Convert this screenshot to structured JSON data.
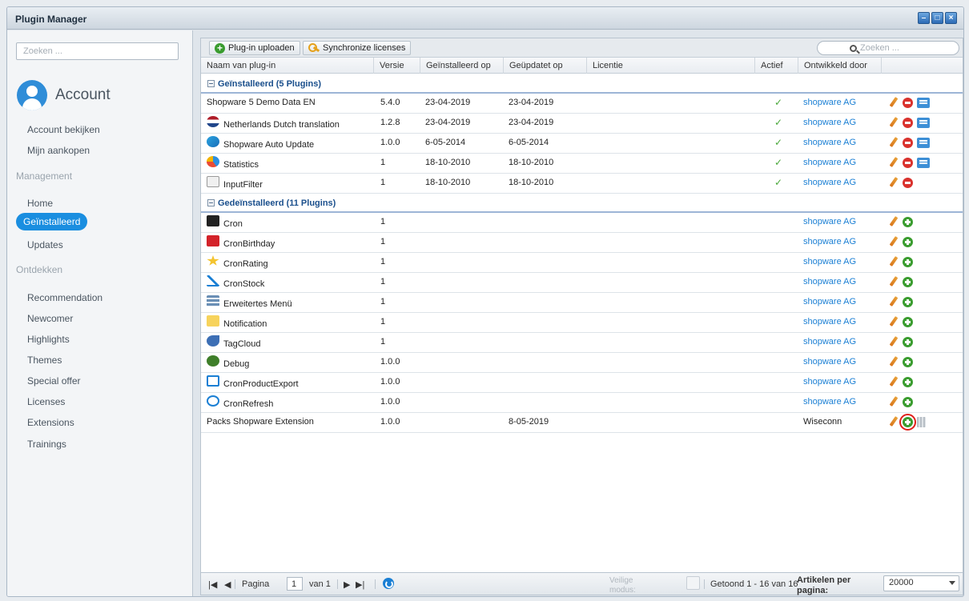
{
  "window": {
    "title": "Plugin Manager"
  },
  "sidebar": {
    "search_placeholder": "Zoeken ...",
    "account_label": "Account",
    "items": {
      "account_view": "Account bekijken",
      "purchases": "Mijn aankopen",
      "management": "Management",
      "home": "Home",
      "installed": "Geïnstalleerd",
      "updates": "Updates",
      "discover": "Ontdekken",
      "recommendation": "Recommendation",
      "newcomer": "Newcomer",
      "highlights": "Highlights",
      "themes": "Themes",
      "special_offer": "Special offer",
      "licenses": "Licenses",
      "extensions": "Extensions",
      "trainings": "Trainings"
    }
  },
  "toolbar": {
    "upload_label": "Plug-in uploaden",
    "sync_label": "Synchronize licenses",
    "search_placeholder": "Zoeken ..."
  },
  "columns": {
    "name": "Naam van plug-in",
    "version": "Versie",
    "installed": "Geïnstalleerd op",
    "updated": "Geüpdatet op",
    "license": "Licentie",
    "active": "Actief",
    "developer": "Ontwikkeld door"
  },
  "groups": {
    "installed": "Geïnstalleerd (5 Plugins)",
    "uninstalled": "Gedeïnstalleerd (11 Plugins)"
  },
  "installed_rows": [
    {
      "name": "Shopware 5 Demo Data EN",
      "version": "5.4.0",
      "installed": "23-04-2019",
      "updated": "23-04-2019",
      "active": "✓",
      "developer": "shopware AG",
      "icon": "none"
    },
    {
      "name": "Netherlands Dutch translation",
      "version": "1.2.8",
      "installed": "23-04-2019",
      "updated": "23-04-2019",
      "active": "✓",
      "developer": "shopware AG",
      "icon": "flag-nl-icon"
    },
    {
      "name": "Shopware Auto Update",
      "version": "1.0.0",
      "installed": "6-05-2014",
      "updated": "6-05-2014",
      "active": "✓",
      "developer": "shopware AG",
      "icon": "update-arrows-icon"
    },
    {
      "name": "Statistics",
      "version": "1",
      "installed": "18-10-2010",
      "updated": "18-10-2010",
      "active": "✓",
      "developer": "shopware AG",
      "icon": "pie-chart-icon"
    },
    {
      "name": "InputFilter",
      "version": "1",
      "installed": "18-10-2010",
      "updated": "18-10-2010",
      "active": "✓",
      "developer": "shopware AG",
      "icon": "text-cursor-icon"
    }
  ],
  "uninstalled_rows": [
    {
      "name": "Cron",
      "version": "1",
      "developer": "shopware AG",
      "icon": "terminal-icon"
    },
    {
      "name": "CronBirthday",
      "version": "1",
      "developer": "shopware AG",
      "icon": "gift-icon"
    },
    {
      "name": "CronRating",
      "version": "1",
      "developer": "shopware AG",
      "icon": "star-icon"
    },
    {
      "name": "CronStock",
      "version": "1",
      "developer": "shopware AG",
      "icon": "stock-chart-icon"
    },
    {
      "name": "Erweitertes Menü",
      "version": "1",
      "developer": "shopware AG",
      "icon": "menu-icon"
    },
    {
      "name": "Notification",
      "version": "1",
      "developer": "shopware AG",
      "icon": "note-icon"
    },
    {
      "name": "TagCloud",
      "version": "1",
      "developer": "shopware AG",
      "icon": "tag-icon"
    },
    {
      "name": "Debug",
      "version": "1.0.0",
      "developer": "shopware AG",
      "icon": "bug-icon"
    },
    {
      "name": "CronProductExport",
      "version": "1.0.0",
      "developer": "shopware AG",
      "icon": "export-icon"
    },
    {
      "name": "CronRefresh",
      "version": "1.0.0",
      "developer": "shopware AG",
      "icon": "refresh-icon"
    },
    {
      "name": "Packs Shopware Extension",
      "version": "1.0.0",
      "updated": "8-05-2019",
      "developer": "Wiseconn",
      "icon": "none"
    }
  ],
  "footer": {
    "page_label": "Pagina",
    "page_value": "1",
    "of_label": "van 1",
    "safe_mode": "Veilige modus:",
    "shown": "Getoond 1 - 16 van 16",
    "per_page": "Artikelen per pagina:",
    "per_page_value": "20000"
  },
  "colors": {
    "accent": "#1a8ee0",
    "link": "#1a7fd4",
    "active_check": "#4aa83b",
    "install": "#3a9c2f",
    "uninstall": "#d9322d"
  }
}
